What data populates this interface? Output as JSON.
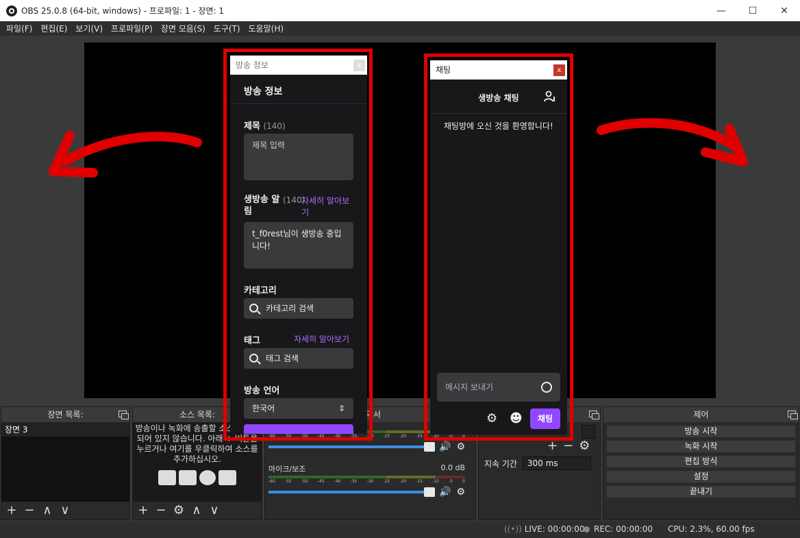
{
  "window": {
    "title": "OBS 25.0.8 (64-bit, windows) - 프로파일: 1 - 장면: 1",
    "minimize": "—",
    "maximize": "☐",
    "close": "✕"
  },
  "menu": [
    "파일(F)",
    "편집(E)",
    "보기(V)",
    "프로파일(P)",
    "장면 모음(S)",
    "도구(T)",
    "도움말(H)"
  ],
  "scenes_dock": {
    "title": "장면 목록:",
    "items": [
      "장면 3"
    ],
    "toolbar": [
      "+",
      "−",
      "∧",
      "∨"
    ]
  },
  "sources_dock": {
    "title": "소스 목록:",
    "empty_message": "방송이나 녹화에 송출할 소스가 설정되어 있지 않습니다. 아래 + 버튼을 누르거나 여기를 우클릭하여 소스를 추가하십시오.",
    "toolbar": [
      "+",
      "−",
      "⚙",
      "∧",
      "∨"
    ]
  },
  "mixer_dock": {
    "title": "믹서",
    "channels": [
      {
        "name": "",
        "db": ""
      },
      {
        "name": "마이크/보조",
        "db": "0.0 dB"
      }
    ],
    "ticks": [
      "-60",
      "-55",
      "-50",
      "-45",
      "-40",
      "-35",
      "-30",
      "-25",
      "-20",
      "-15",
      "-10",
      "-5",
      "0"
    ]
  },
  "transitions_dock": {
    "duration_label": "지속 기간",
    "duration_value": "300 ms"
  },
  "controls_dock": {
    "title": "제어",
    "buttons": [
      "방송 시작",
      "녹화 시작",
      "편집 방식",
      "설정",
      "끝내기"
    ]
  },
  "statusbar": {
    "live": "LIVE: 00:00:00",
    "rec": "REC: 00:00:00",
    "cpu": "CPU: 2.3%, 60.00 fps"
  },
  "stream_info_panel": {
    "window_title": "방송 정보",
    "close": "x",
    "heading": "방송 정보",
    "title_label": "제목",
    "title_count": "(140)",
    "title_placeholder": "제목 입력",
    "notify_label": "생방송 알림",
    "notify_count": "(140)",
    "learn_more": "자세히 알아보기",
    "notify_text": "t_f0rest님이 생방송 중입니다!",
    "category_label": "카테고리",
    "category_placeholder": "카테고리 검색",
    "tags_label": "태그",
    "tags_learn_more": "자세히 알아보기",
    "tags_placeholder": "태그 검색",
    "language_label": "방송 언어",
    "language_value": "한국어"
  },
  "chat_panel": {
    "window_title": "채팅",
    "close": "x",
    "heading": "생방송 채팅",
    "welcome": "채팅방에 오신 것을 환영합니다!",
    "input_placeholder": "메시지 보내기",
    "send_label": "채팅"
  },
  "colors": {
    "annotation_red": "#e00000",
    "twitch_purple": "#9147ff",
    "link_purple": "#a970ff"
  }
}
